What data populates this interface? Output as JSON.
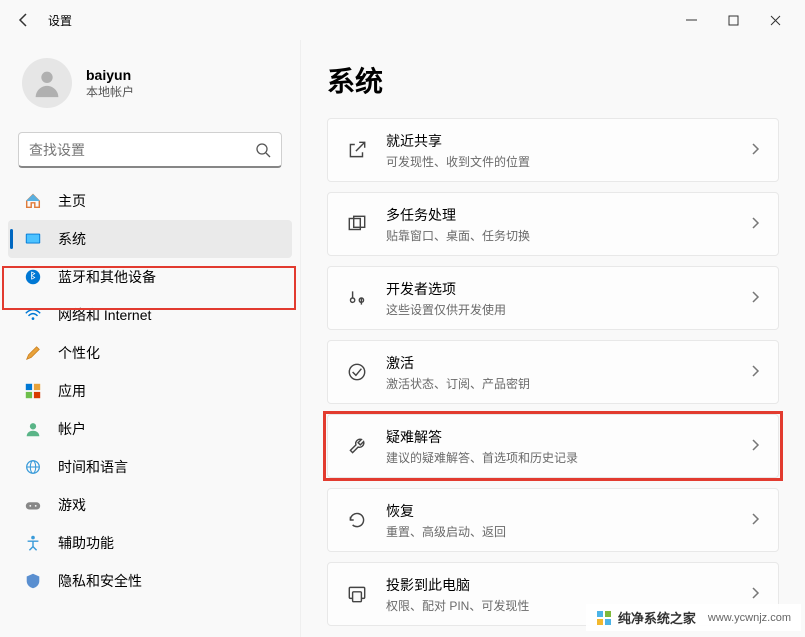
{
  "titlebar": {
    "title": "设置"
  },
  "account": {
    "name": "baiyun",
    "type": "本地帐户"
  },
  "search": {
    "placeholder": "查找设置"
  },
  "nav": {
    "items": [
      {
        "label": "主页",
        "icon": "home"
      },
      {
        "label": "系统",
        "icon": "system",
        "active": true,
        "highlight": true
      },
      {
        "label": "蓝牙和其他设备",
        "icon": "bluetooth"
      },
      {
        "label": "网络和 Internet",
        "icon": "wifi"
      },
      {
        "label": "个性化",
        "icon": "brush"
      },
      {
        "label": "应用",
        "icon": "apps"
      },
      {
        "label": "帐户",
        "icon": "user"
      },
      {
        "label": "时间和语言",
        "icon": "globe"
      },
      {
        "label": "游戏",
        "icon": "game"
      },
      {
        "label": "辅助功能",
        "icon": "access"
      },
      {
        "label": "隐私和安全性",
        "icon": "privacy"
      }
    ]
  },
  "page": {
    "title": "系统"
  },
  "cards": [
    {
      "title": "就近共享",
      "sub": "可发现性、收到文件的位置",
      "icon": "share"
    },
    {
      "title": "多任务处理",
      "sub": "贴靠窗口、桌面、任务切换",
      "icon": "multitask"
    },
    {
      "title": "开发者选项",
      "sub": "这些设置仅供开发使用",
      "icon": "dev"
    },
    {
      "title": "激活",
      "sub": "激活状态、订阅、产品密钥",
      "icon": "check"
    },
    {
      "title": "疑难解答",
      "sub": "建议的疑难解答、首选项和历史记录",
      "icon": "wrench",
      "highlight": true
    },
    {
      "title": "恢复",
      "sub": "重置、高级启动、返回",
      "icon": "recover"
    },
    {
      "title": "投影到此电脑",
      "sub": "权限、配对 PIN、可发现性",
      "icon": "project"
    }
  ],
  "watermark": {
    "text": "纯净系统之家",
    "url": "www.ycwnjz.com"
  }
}
